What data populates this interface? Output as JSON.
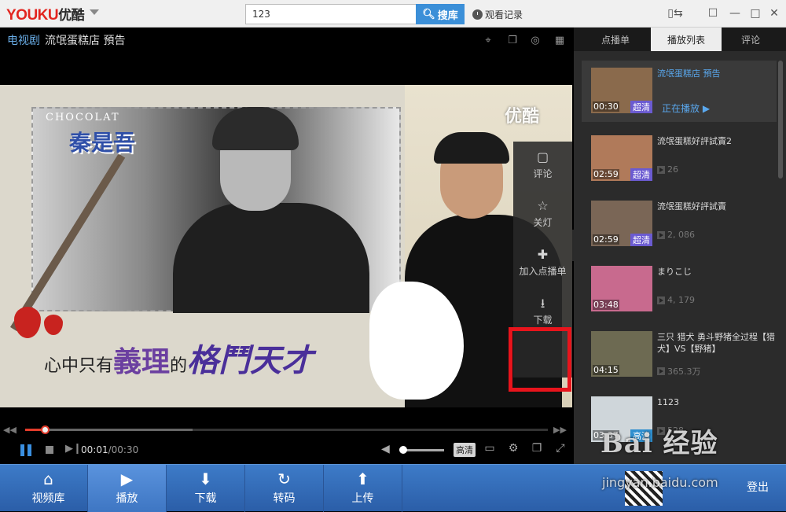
{
  "topbar": {
    "logo_red": "YOUKU",
    "logo_black": "优酷",
    "search_value": "123",
    "search_button": "搜库",
    "history": "观看记录"
  },
  "player": {
    "category": "电视剧",
    "title": "流氓蛋糕店 預告",
    "watermark_logo": "优酷",
    "overlay_chocolate": "CHOCOLAT",
    "overlay_actor": "秦是吾",
    "slogan_1": "心中只有",
    "slogan_2": "義理",
    "slogan_3": "的",
    "slogan_4": "格鬥天才",
    "side_menu": [
      {
        "label": "评论",
        "icon": "comment-icon"
      },
      {
        "label": "关灯",
        "icon": "lightbulb-icon"
      },
      {
        "label": "加入点播单",
        "icon": "plus-icon"
      },
      {
        "label": "下载",
        "icon": "download-icon"
      }
    ],
    "progress": 0.038,
    "buffered": 0.32,
    "time_current": "00:01",
    "time_total": "/00:30",
    "quality": "高清",
    "volume": 0.0
  },
  "sidebar": {
    "tabs": [
      "点播单",
      "播放列表",
      "评论"
    ],
    "active_tab": 1,
    "items": [
      {
        "title": "流氓蛋糕店 預告",
        "duration": "00:30",
        "badge": "超清",
        "now_playing": "正在播放 ▶",
        "views": "",
        "thumb": "#8a6a4c"
      },
      {
        "title": "流氓蛋糕好評試賣2",
        "duration": "02:59",
        "badge": "超清",
        "views": "26",
        "thumb": "#b07a5a"
      },
      {
        "title": "流氓蛋糕好評試賣",
        "duration": "02:59",
        "badge": "超清",
        "views": "2, 086",
        "thumb": "#7a6656"
      },
      {
        "title": "まりこじ",
        "duration": "03:48",
        "badge": "",
        "views": "4, 179",
        "thumb": "#c86a8e"
      },
      {
        "title": "三只 猎犬 勇斗野猪全过程【猎犬】VS【野猪】",
        "duration": "04:15",
        "badge": "",
        "views": "365.3万",
        "thumb": "#6d6a52"
      },
      {
        "title": "1123",
        "duration": "03:37",
        "badge": "高清",
        "views": "528",
        "thumb": "#cfd6da"
      }
    ]
  },
  "bottom_nav": {
    "items": [
      "视频库",
      "播放",
      "下载",
      "转码",
      "上传"
    ],
    "active": 1,
    "logout": "登出"
  },
  "watermark": {
    "text": "Bai 经验",
    "url": "jingyan.baidu.com"
  },
  "colors": {
    "accent": "#3b8fd8",
    "highlight": "#e8141c",
    "progress": "#e33c2b"
  }
}
